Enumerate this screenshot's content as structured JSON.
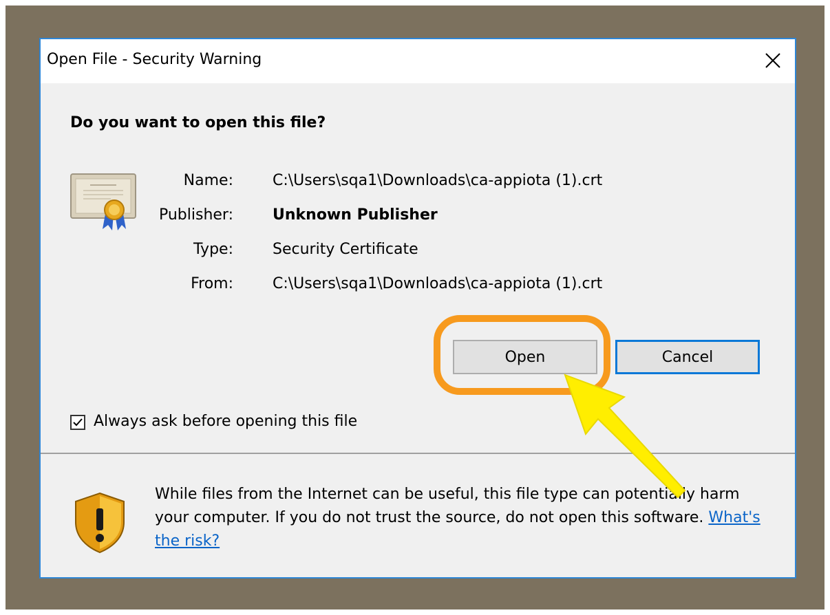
{
  "dialog": {
    "title": "Open File - Security Warning",
    "question": "Do you want to open this file?",
    "fields": {
      "name_label": "Name:",
      "name_value": "C:\\Users\\sqa1\\Downloads\\ca-appiota (1).crt",
      "publisher_label": "Publisher:",
      "publisher_value": "Unknown Publisher",
      "type_label": "Type:",
      "type_value": "Security Certificate",
      "from_label": "From:",
      "from_value": "C:\\Users\\sqa1\\Downloads\\ca-appiota (1).crt"
    },
    "buttons": {
      "open": "Open",
      "cancel": "Cancel"
    },
    "checkbox": {
      "label": "Always ask before opening this file",
      "checked": true
    },
    "warning": {
      "text": "While files from the Internet can be useful, this file type can potentially harm your computer. If you do not trust the source, do not open this software.",
      "link_text": "What's the risk?"
    }
  },
  "annotations": {
    "highlight_color": "#f79a1e",
    "arrow_color": "#ffee00"
  },
  "colors": {
    "desktop_bg": "#7c715e",
    "dialog_border": "#2e86d6",
    "focus_border": "#0a78d7",
    "link": "#0a64c8"
  }
}
